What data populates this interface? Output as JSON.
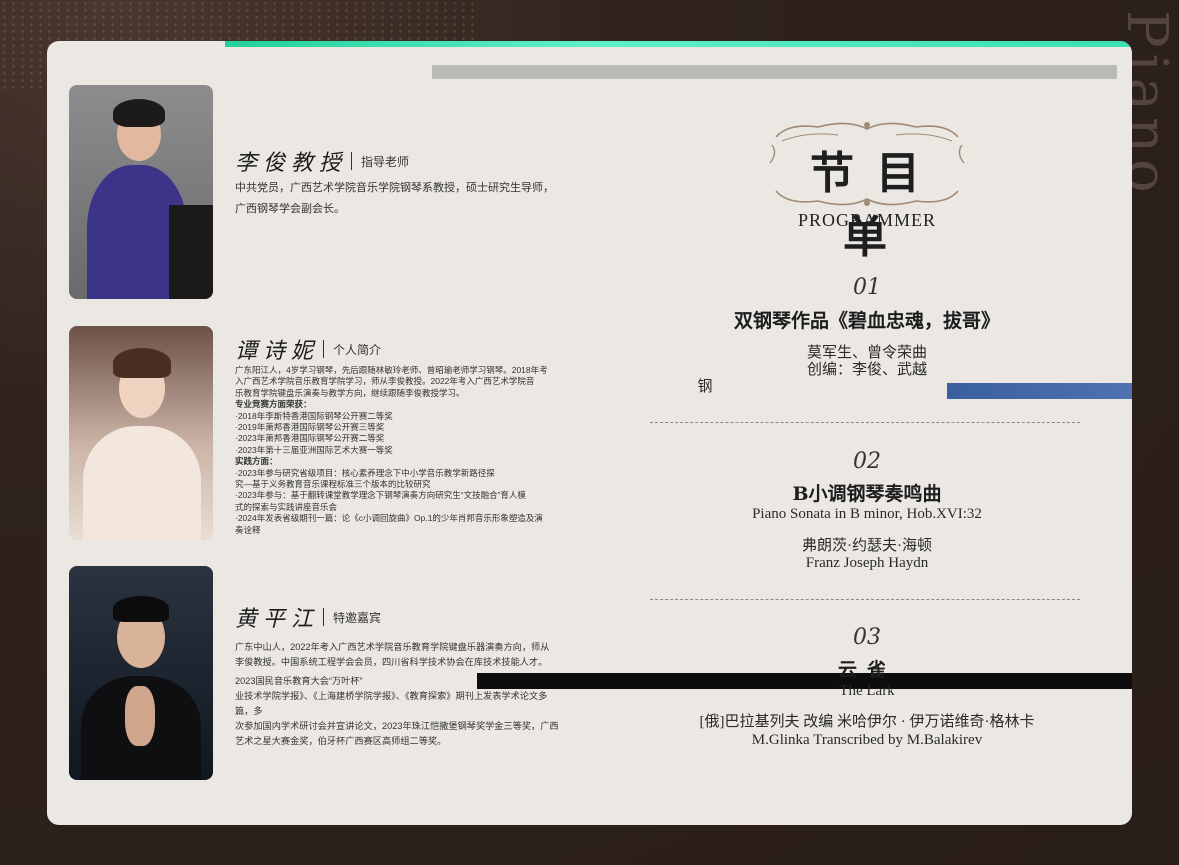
{
  "people": [
    {
      "name": "李俊教授",
      "role": "指导老师",
      "bio": [
        "中共党员，广西艺术学院音乐学院钢琴系教授，硕士研究生导师，",
        "广西钢琴学会副会长。"
      ]
    },
    {
      "name": "谭诗妮",
      "role": "个人简介",
      "bio": [
        "广东阳江人，4岁学习钢琴，先后跟随林敏玲老师、曾昭瑜老师学习钢琴。2018年考",
        "入广西艺术学院音乐教育学院学习，师从李俊教授。2022年考入广西艺术学院音",
        "乐教育学院键盘乐演奏与教学方向，继续跟随李俊教授学习。",
        "专业竞赛方面荣获：",
        "·2018年李斯特香港国际钢琴公开赛二等奖",
        "·2019年萧邦香港国际钢琴公开赛三等奖",
        "·2023年萧邦香港国际钢琴公开赛二等奖",
        "·2023年第十三届亚洲国际艺术大赛一等奖",
        "实践方面：",
        "·2023年参与研究省级项目：核心素养理念下中小学音乐教学新路径探",
        "究—基于义务教育音乐课程标准三个版本的比较研究",
        "·2023年参与：基于翻转课堂教学理念下钢琴演奏方向研究生“文技融合”育人模",
        "式的探索与实践讲座音乐会",
        "·2024年发表省级期刊一篇：论《c小调回旋曲》Op.1的少年肖邦音乐形象塑造及演",
        "奏诠释"
      ]
    },
    {
      "name": "黄平江",
      "role": "特邀嘉宾",
      "bio": [
        "广东中山人，2022年考入广西艺术学院音乐教育学院键盘乐器演奏方向，师从",
        "李俊教授。中国系统工程学会会员，四川省科学技术协会在库技术技能人才。",
        "2023国民音乐教育大会“万叶杯”",
        "业技术学院学报》、《上海建桥学院学报》、《教育探索》期刊上发表学术论文多篇，多",
        "次参加国内学术研讨会并宣讲论文，2023年珠江恺撒堡钢琴奖学金三等奖，广西",
        "艺术之星大赛金奖，伯牙杯广西赛区高师组二等奖。"
      ]
    }
  ],
  "program": {
    "title": "节目单",
    "subtitle": "PROGRAMMER",
    "items": [
      {
        "num": "01",
        "title": "双钢琴作品《碧血忠魂，拔哥》",
        "lines": [
          "莫军生、曾令荣曲",
          "创编：李俊、武越",
          "钢"
        ]
      },
      {
        "num": "02",
        "title": "B小调钢琴奏鸣曲",
        "lines": [
          "Piano Sonata in B minor, Hob.XVI:32",
          "弗朗茨·约瑟夫·海顿",
          "Franz Joseph Haydn"
        ]
      },
      {
        "num": "03",
        "title": "云雀",
        "lines": [
          "The Lark",
          "[俄]巴拉基列夫 改编 米哈伊尔 · 伊万诺维奇·格林卡",
          "M.Glinka Transcribed by M.Balakirev"
        ]
      }
    ]
  },
  "colors": {
    "card": "#ebe8e4",
    "background": "#2e211c",
    "ornament": "#a08a74"
  }
}
